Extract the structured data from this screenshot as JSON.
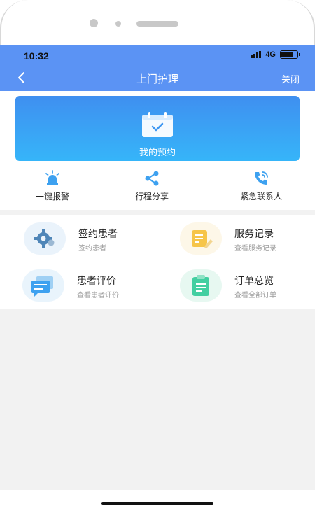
{
  "status_bar": {
    "time": "10:32",
    "network": "4G"
  },
  "nav": {
    "title": "上门护理",
    "close_label": "关闭"
  },
  "booking": {
    "label": "我的预约"
  },
  "quick_actions": [
    {
      "label": "一键报警",
      "icon": "alarm-light-icon"
    },
    {
      "label": "行程分享",
      "icon": "share-icon"
    },
    {
      "label": "紧急联系人",
      "icon": "phone-contact-icon"
    }
  ],
  "menu": [
    {
      "title": "签约患者",
      "subtitle": "签约患者",
      "icon": "gear-user-icon"
    },
    {
      "title": "服务记录",
      "subtitle": "查看服务记录",
      "icon": "memo-edit-icon"
    },
    {
      "title": "患者评价",
      "subtitle": "查看患者评价",
      "icon": "chat-bubbles-icon"
    },
    {
      "title": "订单总览",
      "subtitle": "查看全部订单",
      "icon": "clipboard-icon"
    }
  ],
  "colors": {
    "nav_bar": "#5b93f4",
    "card_gradient_top": "#3f8ff0",
    "card_gradient_bottom": "#36b5f9",
    "accent_blue": "#3da1f0",
    "accent_yellow": "#f6c54a",
    "accent_green": "#43cfa1"
  }
}
